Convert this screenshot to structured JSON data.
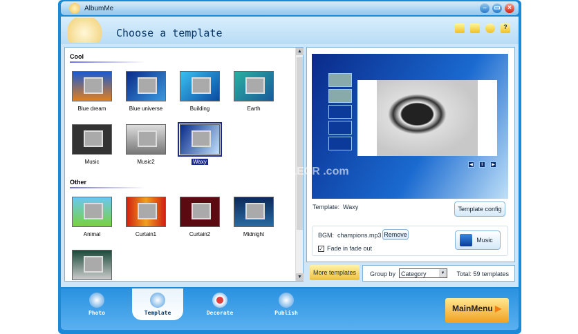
{
  "app": {
    "title": "AlbumMe"
  },
  "header": {
    "title": "Choose a template"
  },
  "templates": {
    "sections": [
      {
        "name": "Cool",
        "items": [
          "Blue dream",
          "Blue universe",
          "Building",
          "Earth",
          "Music",
          "Music2",
          "Waxy"
        ]
      },
      {
        "name": "Other",
        "items": [
          "Animal",
          "Curtain1",
          "Curtain2",
          "Midnight",
          ""
        ]
      }
    ],
    "selected": "Waxy"
  },
  "preview": {
    "template_label": "Template:",
    "template_name": "Waxy",
    "config_button": "Template config"
  },
  "bgm": {
    "label": "BGM:",
    "file": "champions.mp3",
    "remove_button": "Remove",
    "fade_label": "Fade in fade out",
    "fade_checked": true,
    "music_button": "Music"
  },
  "footer": {
    "more_templates": "More templates",
    "group_by_label": "Group by",
    "group_by_value": "Category",
    "total": "Total: 59 templates"
  },
  "nav": {
    "items": [
      "Photo",
      "Template",
      "Decorate",
      "Publish"
    ],
    "active": "Template",
    "main_menu": "MainMenu"
  },
  "watermark": "FILECR .com"
}
